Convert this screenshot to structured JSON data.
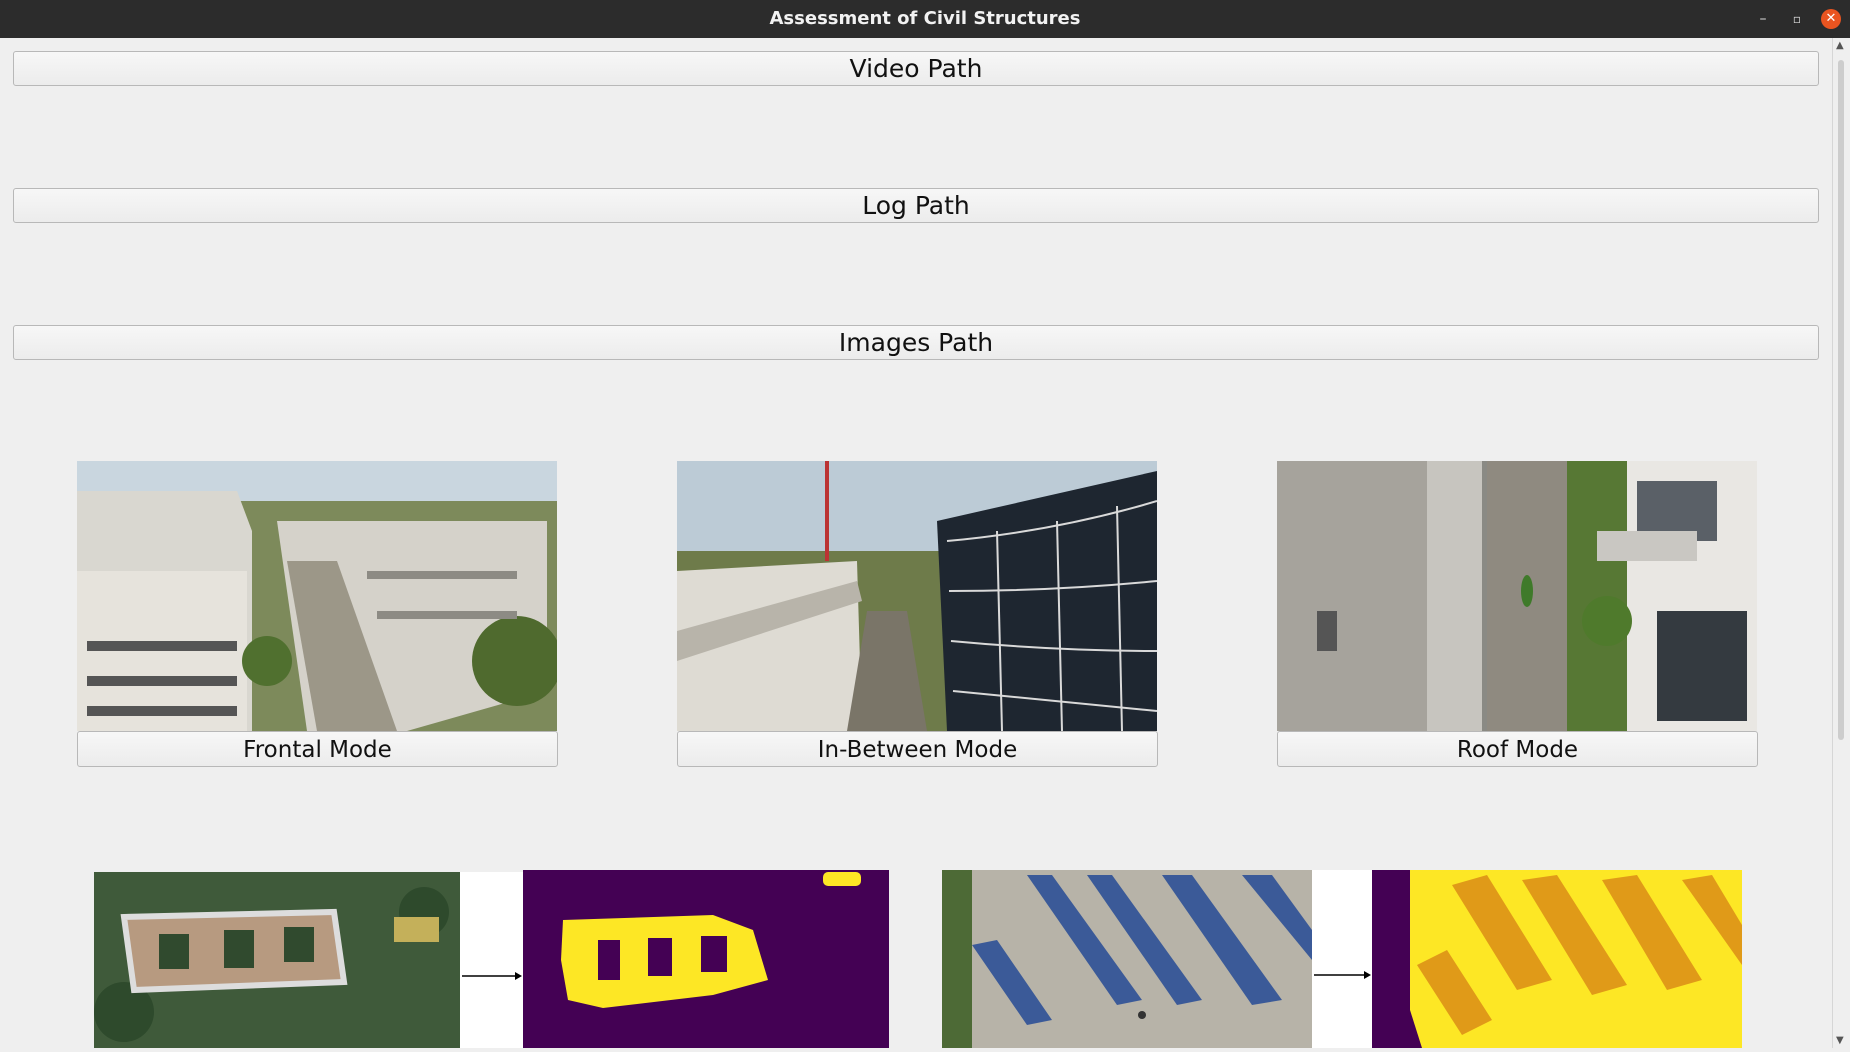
{
  "window": {
    "title": "Assessment of Civil Structures",
    "controls": {
      "minimize": "–",
      "maximize": "▫",
      "close": "✕"
    }
  },
  "paths": {
    "video": "Video Path",
    "log": "Log Path",
    "images": "Images Path"
  },
  "modes": {
    "frontal": "Frontal Mode",
    "in_between": "In-Between Mode",
    "roof": "Roof Mode"
  },
  "colors": {
    "segmentation_background": "#440154",
    "segmentation_foreground": "#fde725",
    "segmentation_panels": "#e09a18"
  }
}
